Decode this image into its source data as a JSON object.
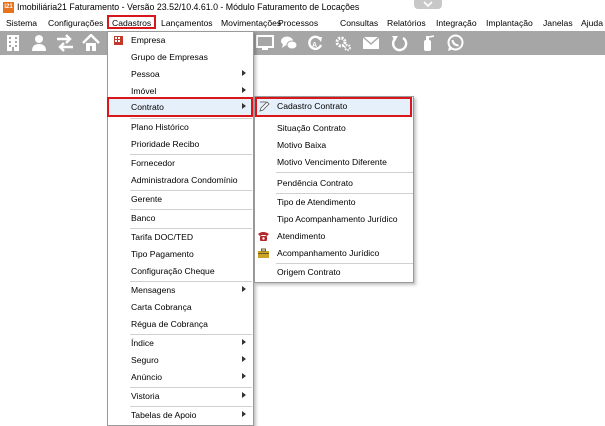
{
  "window": {
    "title": "Imobiliária21 Faturamento - Versão 23.52/10.4.61.0 - Módulo Faturamento de Locações",
    "app_icon_text": "i21",
    "accent_color": "#e8731a",
    "highlight_color": "#d9161c"
  },
  "menubar": {
    "items": [
      {
        "label": "Sistema"
      },
      {
        "label": "Configurações"
      },
      {
        "label": "Cadastros"
      },
      {
        "label": "Lançamentos"
      },
      {
        "label": "Movimentações"
      },
      {
        "label": "Processos"
      },
      {
        "label": "Consultas"
      },
      {
        "label": "Relatórios"
      },
      {
        "label": "Integração"
      },
      {
        "label": "Implantação"
      },
      {
        "label": "Janelas"
      },
      {
        "label": "Ajuda"
      }
    ]
  },
  "toolbar": {
    "icons": [
      "building-icon",
      "user-icon",
      "transfer-icon",
      "home-icon",
      "monitor-icon",
      "chat-icon",
      "refresh-cycle-icon",
      "gears-icon",
      "mail-icon",
      "undo-icon",
      "fire-extinguisher-icon",
      "whatsapp-icon"
    ]
  },
  "cadastros_menu": {
    "items": [
      {
        "label": "Empresa",
        "icon": "company-icon"
      },
      {
        "label": "Grupo de Empresas"
      },
      {
        "label": "Pessoa",
        "submenu": true
      },
      {
        "label": "Imóvel",
        "submenu": true
      },
      {
        "label": "Contrato",
        "submenu": true
      },
      {
        "label": "Plano Histórico"
      },
      {
        "label": "Prioridade Recibo"
      },
      {
        "label": "Fornecedor"
      },
      {
        "label": "Administradora Condomínio"
      },
      {
        "label": "Gerente"
      },
      {
        "label": "Banco"
      },
      {
        "label": "Tarifa DOC/TED"
      },
      {
        "label": "Tipo Pagamento"
      },
      {
        "label": "Configuração Cheque"
      },
      {
        "label": "Mensagens",
        "submenu": true
      },
      {
        "label": "Carta Cobrança"
      },
      {
        "label": "Régua de Cobrança"
      },
      {
        "label": "Índice",
        "submenu": true
      },
      {
        "label": "Seguro",
        "submenu": true
      },
      {
        "label": "Anúncio",
        "submenu": true
      },
      {
        "label": "Vistoria",
        "submenu": true
      },
      {
        "label": "Tabelas de Apoio",
        "submenu": true
      }
    ]
  },
  "contrato_submenu": {
    "items": [
      {
        "label": "Cadastro Contrato",
        "icon": "edit-pencil-icon"
      },
      {
        "label": "Situação Contrato"
      },
      {
        "label": "Motivo Baixa"
      },
      {
        "label": "Motivo Vencimento Diferente"
      },
      {
        "label": "Pendência Contrato"
      },
      {
        "label": "Tipo de Atendimento"
      },
      {
        "label": "Tipo Acompanhamento Jurídico"
      },
      {
        "label": "Atendimento",
        "icon": "telephone-icon"
      },
      {
        "label": "Acompanhamento Jurídico",
        "icon": "briefcase-icon"
      },
      {
        "label": "Origem Contrato"
      }
    ]
  }
}
